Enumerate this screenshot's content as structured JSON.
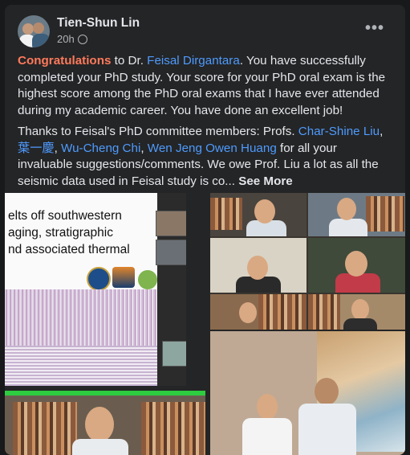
{
  "post": {
    "author": "Tien-Shun Lin",
    "time": "20h",
    "privacy_icon": "globe-icon",
    "more_icon": "more-options-icon",
    "paragraph1": {
      "highlight": "Congratulations",
      "part1": " to Dr. ",
      "mention": "Feisal Dirgantara",
      "part2": ". You have successfully completed your PhD study. Your score for your PhD oral exam is the highest score among the PhD oral exams that I have ever attended during my academic career. You have done an excellent job!"
    },
    "paragraph2": {
      "part1": "Thanks to Feisal's PhD committee members: Profs. ",
      "m1": "Char-Shine Liu",
      "sep1": ",",
      "m2": "葉一慶",
      "sep2": ", ",
      "m3": "Wu-Cheng Chi",
      "sep3": ", ",
      "m4": "Wen Jeng Owen Huang",
      "part2": " for all your invaluable suggestions/comments. We owe Prof. Liu a lot as all the seismic data used in Feisal study is co... ",
      "see_more": "See More"
    }
  },
  "slide": {
    "line1": "elts off southwestern",
    "line2": "aging, stratigraphic",
    "line3": "nd associated thermal"
  }
}
